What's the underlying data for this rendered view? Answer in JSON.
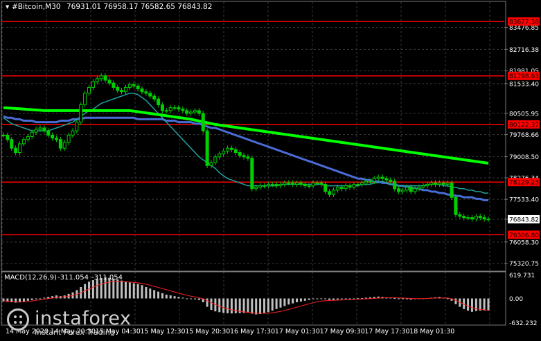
{
  "header": {
    "symbol": "#Bitcoin,M30",
    "ohlc": "76931.01 76958.17 76582.65 76843.82"
  },
  "macd": {
    "label": "MACD(12,26,9)",
    "main": "-311.054",
    "signal": "-311.054"
  },
  "logo": {
    "name": "instaforex",
    "tagline": "Instant Forex Trading"
  },
  "colors": {
    "background": "#000000",
    "grid": "#3a3a3a",
    "candle": "#00d000",
    "level_line": "#ff0000",
    "ma_fast": "#22a0a0",
    "ma_mid": "#4a6cd6",
    "ma_slow": "#00ff00",
    "macd_hist": "#c0c0c0",
    "macd_signal": "#ff2020"
  },
  "chart_data": {
    "type": "candlestick",
    "price_axis": {
      "range": [
        75050,
        84350
      ],
      "tick_labels": [
        "83476.85",
        "82716.38",
        "81981.05",
        "81533.40",
        "80505.95",
        "79768.66",
        "79008.50",
        "78276.34",
        "77533.40",
        "76843.82",
        "76058.30",
        "75320.75"
      ]
    },
    "current_price": "76843.82",
    "levels": [
      {
        "label": "83677.38",
        "value": 83677.38
      },
      {
        "label": "81798.63",
        "value": 81798.63
      },
      {
        "label": "80122.37",
        "value": 80122.37
      },
      {
        "label": "78129.23",
        "value": 78129.23
      },
      {
        "label": "76306.80",
        "value": 76306.8
      }
    ],
    "time_labels": [
      "14 May 2020",
      "14 May 20:30",
      "15 May 04:30",
      "15 May 12:30",
      "15 May 20:30",
      "16 May 17:30",
      "17 May 01:30",
      "17 May 09:30",
      "17 May 17:30",
      "18 May 01:30"
    ],
    "close": [
      79750,
      79600,
      79300,
      79150,
      79450,
      79600,
      79700,
      79850,
      79950,
      80000,
      79900,
      79750,
      79650,
      79600,
      79300,
      79500,
      79750,
      79900,
      80200,
      80800,
      81200,
      81400,
      81600,
      81700,
      81800,
      81650,
      81550,
      81400,
      81300,
      81250,
      81400,
      81500,
      81450,
      81350,
      81250,
      81200,
      81100,
      81000,
      80800,
      80600,
      80600,
      80700,
      80700,
      80650,
      80600,
      80500,
      80550,
      80600,
      80500,
      79900,
      78700,
      78800,
      79000,
      79100,
      79200,
      79300,
      79250,
      79150,
      79050,
      79000,
      78950,
      77900,
      77950,
      78000,
      78000,
      78050,
      78050,
      78000,
      78050,
      78100,
      78100,
      78050,
      78100,
      78050,
      78000,
      78000,
      78100,
      78100,
      78050,
      77800,
      77700,
      77850,
      77950,
      77900,
      78000,
      77950,
      78050,
      78050,
      78100,
      78150,
      78150,
      78250,
      78300,
      78250,
      78200,
      78150,
      77900,
      77800,
      77850,
      77950,
      77800,
      77900,
      77950,
      78000,
      78050,
      78100,
      78050,
      78100,
      78050,
      78100,
      77600,
      77000,
      76950,
      76900,
      76900,
      76850,
      76950,
      76900,
      76850,
      76843.82
    ],
    "ma_fast": [
      80350,
      80250,
      80150,
      80100,
      80050,
      80000,
      79950,
      79900,
      79900,
      79900,
      79900,
      79900,
      79950,
      80000,
      80050,
      80100,
      80150,
      80200,
      80300,
      80400,
      80500,
      80600,
      80650,
      80750,
      80850,
      80900,
      80950,
      81000,
      81050,
      81100,
      81150,
      81200,
      81200,
      81150,
      81050,
      80950,
      80800,
      80650,
      80500,
      80350,
      80200,
      80050,
      79900,
      79750,
      79600,
      79450,
      79300,
      79150,
      79000,
      78900,
      78800,
      78700,
      78600,
      78450,
      78350,
      78250,
      78200,
      78150,
      78100,
      78050,
      78000,
      78000,
      78000,
      78000,
      78000,
      78000,
      78000,
      78000,
      78050,
      78050,
      78050,
      78050,
      78050,
      78050,
      78050,
      78050,
      78050,
      78050,
      78050,
      78000,
      78000,
      78000,
      78000,
      78000,
      78000,
      78000,
      78000,
      78000,
      78050,
      78050,
      78050,
      78100,
      78100,
      78150,
      78100,
      78050,
      78000,
      78000,
      78000,
      78000,
      78000,
      78000,
      78000,
      78000,
      78050,
      78050,
      78050,
      78050,
      78000,
      78000,
      77950,
      77950,
      77900,
      77900,
      77850,
      77850,
      77800,
      77800,
      77750,
      77750
    ],
    "ma_mid": [
      80400,
      80350,
      80350,
      80300,
      80300,
      80250,
      80250,
      80250,
      80200,
      80200,
      80200,
      80200,
      80200,
      80200,
      80250,
      80250,
      80250,
      80300,
      80300,
      80300,
      80350,
      80350,
      80350,
      80350,
      80350,
      80350,
      80350,
      80350,
      80350,
      80350,
      80350,
      80350,
      80350,
      80300,
      80300,
      80300,
      80300,
      80300,
      80300,
      80300,
      80250,
      80250,
      80250,
      80200,
      80200,
      80200,
      80200,
      80150,
      80150,
      80100,
      80050,
      80000,
      80000,
      79950,
      79900,
      79850,
      79800,
      79750,
      79700,
      79650,
      79600,
      79550,
      79500,
      79450,
      79400,
      79350,
      79300,
      79250,
      79200,
      79150,
      79100,
      79050,
      79000,
      78950,
      78900,
      78850,
      78800,
      78750,
      78700,
      78650,
      78600,
      78550,
      78500,
      78450,
      78400,
      78350,
      78300,
      78250,
      78250,
      78200,
      78200,
      78150,
      78150,
      78100,
      78100,
      78050,
      78050,
      78000,
      78000,
      77950,
      77950,
      77900,
      77900,
      77850,
      77850,
      77800,
      77800,
      77750,
      77750,
      77700,
      77700,
      77650,
      77650,
      77600,
      77600,
      77600,
      77550,
      77550,
      77500,
      77500
    ],
    "ma_slow": [
      80700,
      80690,
      80680,
      80670,
      80660,
      80650,
      80640,
      80630,
      80620,
      80610,
      80600,
      80600,
      80600,
      80600,
      80600,
      80600,
      80600,
      80600,
      80600,
      80600,
      80600,
      80600,
      80600,
      80600,
      80600,
      80600,
      80600,
      80600,
      80600,
      80600,
      80600,
      80600,
      80580,
      80560,
      80540,
      80520,
      80500,
      80480,
      80460,
      80440,
      80420,
      80400,
      80380,
      80360,
      80340,
      80320,
      80300,
      80270,
      80240,
      80210,
      80180,
      80150,
      80120,
      80100,
      80080,
      80060,
      80040,
      80020,
      80000,
      79980,
      79960,
      79940,
      79920,
      79900,
      79880,
      79860,
      79840,
      79820,
      79800,
      79780,
      79760,
      79740,
      79720,
      79700,
      79680,
      79660,
      79640,
      79620,
      79600,
      79580,
      79560,
      79540,
      79520,
      79500,
      79480,
      79460,
      79440,
      79420,
      79400,
      79380,
      79360,
      79340,
      79320,
      79300,
      79280,
      79260,
      79240,
      79220,
      79200,
      79180,
      79160,
      79140,
      79120,
      79100,
      79080,
      79060,
      79040,
      79020,
      79000,
      78980,
      78960,
      78940,
      78920,
      78900,
      78880,
      78860,
      78840,
      78820,
      78800,
      78780
    ],
    "macd_axis": {
      "range": [
        -700,
        700
      ],
      "tick_labels": [
        "619.731",
        "0.00",
        "-632.232"
      ]
    },
    "macd_histogram": [
      -80,
      -90,
      -100,
      -110,
      -100,
      -80,
      -60,
      -40,
      -20,
      0,
      20,
      40,
      60,
      80,
      60,
      80,
      120,
      160,
      220,
      300,
      380,
      440,
      480,
      520,
      540,
      560,
      540,
      520,
      500,
      470,
      440,
      420,
      400,
      380,
      350,
      300,
      260,
      220,
      180,
      140,
      100,
      80,
      60,
      40,
      20,
      0,
      -10,
      -20,
      -40,
      -100,
      -220,
      -300,
      -340,
      -360,
      -380,
      -390,
      -395,
      -390,
      -385,
      -380,
      -370,
      -400,
      -420,
      -410,
      -390,
      -360,
      -320,
      -280,
      -240,
      -200,
      -160,
      -130,
      -100,
      -80,
      -60,
      -40,
      -20,
      -10,
      0,
      -20,
      -40,
      -40,
      -30,
      -20,
      -10,
      -5,
      0,
      5,
      10,
      20,
      30,
      40,
      50,
      40,
      30,
      20,
      10,
      0,
      -10,
      -20,
      -30,
      -20,
      -10,
      0,
      10,
      20,
      30,
      40,
      20,
      0,
      -60,
      -150,
      -220,
      -280,
      -320,
      -350,
      -330,
      -320,
      -315,
      -311
    ],
    "macd_signal": [
      -60,
      -70,
      -80,
      -90,
      -95,
      -90,
      -80,
      -65,
      -50,
      -35,
      -20,
      -5,
      10,
      25,
      35,
      45,
      60,
      80,
      110,
      150,
      200,
      250,
      300,
      340,
      380,
      410,
      430,
      440,
      445,
      445,
      440,
      430,
      420,
      410,
      395,
      375,
      350,
      320,
      290,
      260,
      230,
      200,
      170,
      140,
      110,
      85,
      60,
      40,
      20,
      -10,
      -60,
      -110,
      -160,
      -200,
      -240,
      -270,
      -300,
      -320,
      -340,
      -355,
      -365,
      -375,
      -385,
      -390,
      -390,
      -385,
      -375,
      -360,
      -340,
      -315,
      -290,
      -260,
      -230,
      -200,
      -170,
      -140,
      -115,
      -90,
      -70,
      -60,
      -55,
      -50,
      -45,
      -40,
      -35,
      -30,
      -25,
      -20,
      -15,
      -10,
      -5,
      0,
      10,
      15,
      20,
      20,
      20,
      15,
      10,
      5,
      0,
      -5,
      -5,
      -5,
      0,
      5,
      10,
      15,
      15,
      10,
      -10,
      -50,
      -100,
      -150,
      -200,
      -240,
      -270,
      -290,
      -300,
      -311
    ]
  }
}
